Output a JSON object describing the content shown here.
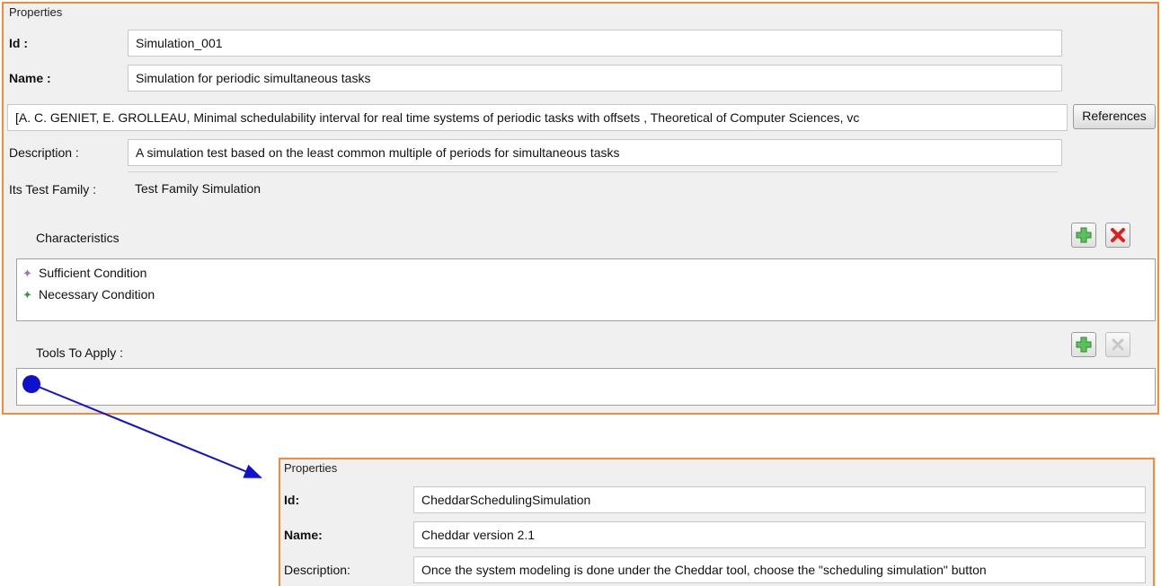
{
  "panel1": {
    "title": "Properties",
    "id_label": "Id :",
    "id_value": "Simulation_001",
    "name_label": "Name :",
    "name_value": "Simulation for periodic simultaneous tasks",
    "reference_value": "[A. C. GENIET, E. GROLLEAU, Minimal schedulability interval for real time systems of periodic tasks with offsets , Theoretical of Computer Sciences, vc",
    "references_button": "References",
    "description_label": "Description :",
    "description_value": "A simulation test based on the least common multiple of periods for simultaneous tasks",
    "family_label": "Its Test Family :",
    "family_value": "Test Family Simulation",
    "characteristics_label": "Characteristics",
    "characteristics": [
      {
        "label": "Sufficient Condition",
        "icon": "purple-diamond-icon",
        "color": "#a070b8"
      },
      {
        "label": "Necessary Condition",
        "icon": "green-diamond-icon",
        "color": "#3a9a4a"
      }
    ],
    "tools_label": "Tools To Apply :"
  },
  "panel2": {
    "title": "Properties",
    "id_label": "Id:",
    "id_value": "CheddarSchedulingSimulation",
    "name_label": "Name:",
    "name_value": "Cheddar version 2.1",
    "description_label": "Description:",
    "description_value": "Once the system modeling is done under the Cheddar tool, choose the \"scheduling simulation\" button"
  },
  "colors": {
    "frame": "#f08c3c",
    "arrow": "#1010d0",
    "add": "#3aa83a",
    "delete": "#e02020"
  }
}
